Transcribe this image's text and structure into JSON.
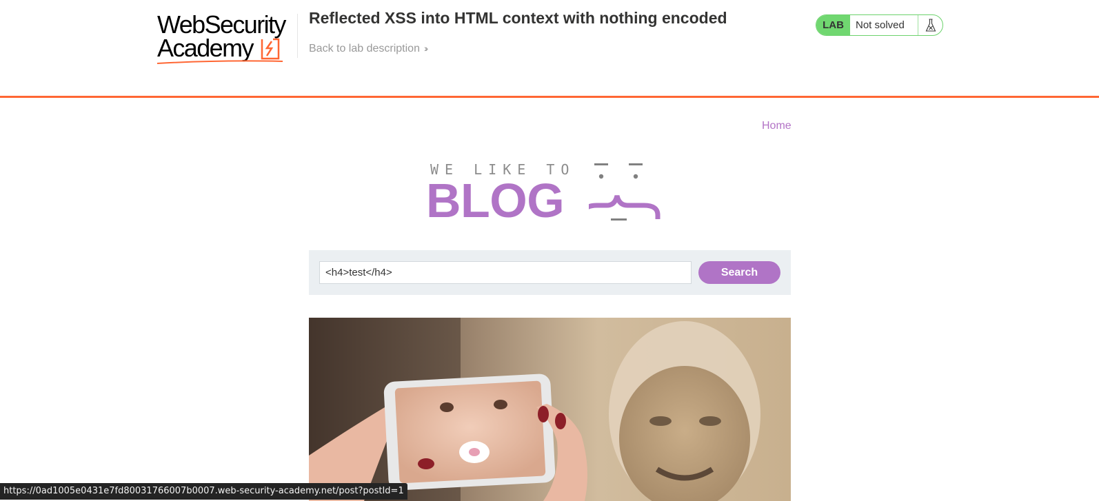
{
  "academy": {
    "logo_line1": "WebSecurity",
    "logo_line2": "Academy",
    "lab_title": "Reflected XSS into HTML context with nothing encoded",
    "back_link": "Back to lab description",
    "status_badge_label": "LAB",
    "status_text": "Not solved",
    "accent_color": "#ff6633",
    "status_color": "#70d770"
  },
  "blog": {
    "nav_home": "Home",
    "logo_tagline": "WE LIKE TO",
    "logo_word": "BLOG",
    "search_value": "<h4>test</h4>",
    "search_button": "Search",
    "brand_color": "#b074c6"
  },
  "browser": {
    "status_url": "https://0ad1005e0431e7fd80031766007b0007.web-security-academy.net/post?postId=1"
  }
}
